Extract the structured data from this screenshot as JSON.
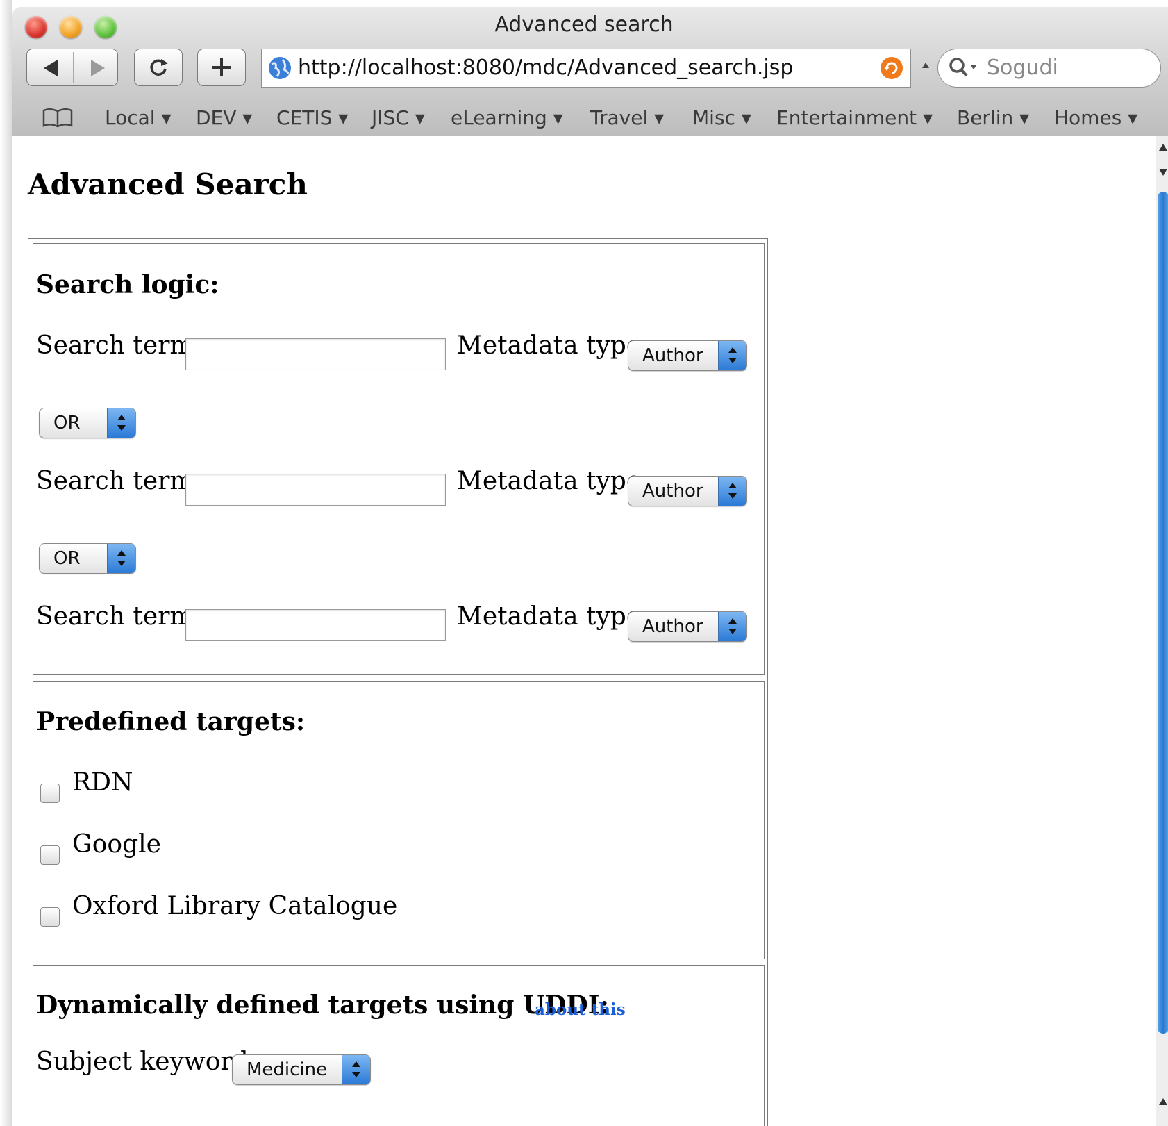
{
  "window": {
    "title": "Advanced search"
  },
  "toolbar": {
    "url": "http://localhost:8080/mdc/Advanced_search.jsp",
    "search_placeholder": "Sogudi"
  },
  "bookmarks": [
    {
      "label": "Local ▾"
    },
    {
      "label": "DEV ▾"
    },
    {
      "label": "CETIS ▾"
    },
    {
      "label": "JISC ▾"
    },
    {
      "label": "eLearning ▾"
    },
    {
      "label": "Travel ▾"
    },
    {
      "label": "Misc ▾"
    },
    {
      "label": "Entertainment ▾"
    },
    {
      "label": "Berlin ▾"
    },
    {
      "label": "Homes ▾"
    }
  ],
  "page": {
    "heading": "Advanced Search",
    "search_logic": {
      "heading": "Search logic:",
      "rows": [
        {
          "term_label": "Search term:",
          "term_value": "",
          "type_label": "Metadata type:",
          "type_value": "Author"
        },
        {
          "term_label": "Search term:",
          "term_value": "",
          "type_label": "Metadata type:",
          "type_value": "Author"
        },
        {
          "term_label": "Search term:",
          "term_value": "",
          "type_label": "Metadata type:",
          "type_value": "Author"
        }
      ],
      "operators": [
        "OR",
        "OR"
      ]
    },
    "predefined": {
      "heading": "Predefined targets:",
      "targets": [
        {
          "label": "RDN",
          "checked": false
        },
        {
          "label": "Google",
          "checked": false
        },
        {
          "label": "Oxford Library Catalogue",
          "checked": false
        }
      ]
    },
    "dynamic": {
      "heading": "Dynamically defined targets using UDDI:",
      "about_link": "about this",
      "keyword_label": "Subject keyword",
      "keyword_value": "Medicine"
    }
  },
  "colors": {
    "link": "#1a5ed8",
    "select_arrow": "#2b7ad6",
    "scroll_thumb": "#2a78d0"
  }
}
